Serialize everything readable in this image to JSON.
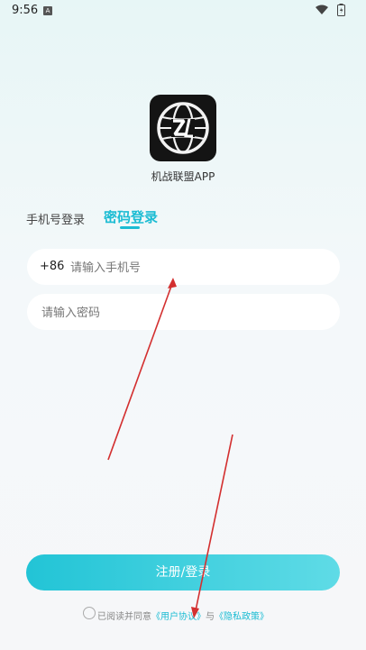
{
  "status_bar": {
    "time": "9:56",
    "notification_icon": "A"
  },
  "app": {
    "name": "机战联盟APP",
    "logo_icon": "zl-globe-logo"
  },
  "tabs": {
    "phone_login": "手机号登录",
    "password_login": "密码登录",
    "active": "password_login"
  },
  "form": {
    "country_code": "+86",
    "phone_placeholder": "请输入手机号",
    "password_placeholder": "请输入密码"
  },
  "submit_label": "注册/登录",
  "agreement": {
    "prefix": "已阅读并同意",
    "user_agreement": "《用户协议》",
    "and": "与",
    "privacy_policy": "《隐私政策》"
  },
  "colors": {
    "accent": "#1bbcd3",
    "annotation": "#d32f2f"
  }
}
